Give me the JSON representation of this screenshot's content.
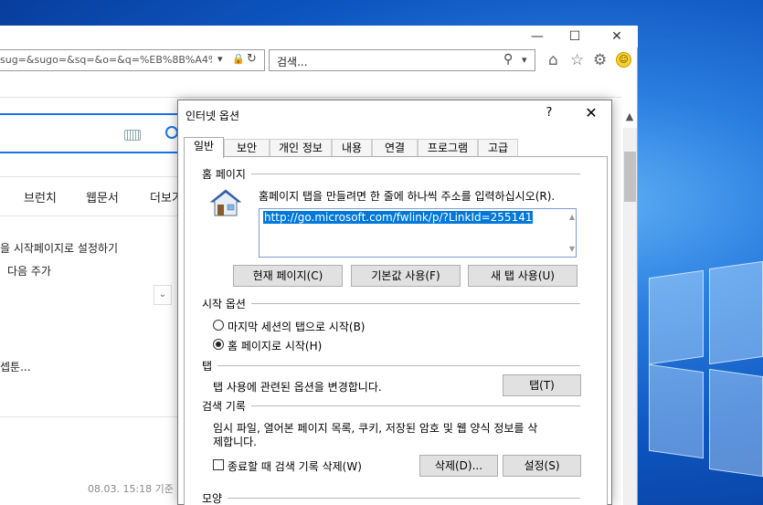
{
  "colors": {
    "accent": "#1a73e8",
    "selection": "#0078d7",
    "desktop": "#0d55c0"
  },
  "browser": {
    "window_controls": {
      "minimize": "—",
      "maximize": "☐",
      "close": "✕"
    },
    "address": {
      "value": "sug=&sugo=&sq=&o=&q=%EB%8B%A4%",
      "icons": [
        "dropdown-icon",
        "lock-icon",
        "refresh-icon"
      ]
    },
    "search": {
      "placeholder": "검색...",
      "icons": [
        "search-icon",
        "dropdown-icon"
      ]
    },
    "toolbar_icons": [
      "home-icon",
      "star-icon",
      "gear-icon",
      "smiley-icon"
    ],
    "page": {
      "nav": [
        "브런치",
        "웹문서",
        "더보기"
      ],
      "side": [
        "을 시작페이지로 설정하기",
        "다음 주가",
        "셉툰..."
      ],
      "timestamp": "08.03. 15:18 기준"
    }
  },
  "dialog": {
    "title": "인터넷 옵션",
    "help": "?",
    "close": "✕",
    "tabs": [
      "일반",
      "보안",
      "개인 정보",
      "내용",
      "연결",
      "프로그램",
      "고급"
    ],
    "active_tab": 0,
    "homepage": {
      "section": "홈 페이지",
      "instruction": "홈페이지 탭을 만들려면 한 줄에 하나씩 주소를 입력하십시오(R).",
      "url": "http://go.microsoft.com/fwlink/p/?LinkId=255141",
      "buttons": {
        "current": "현재 페이지(C)",
        "default": "기본값 사용(F)",
        "new_tab": "새 탭 사용(U)"
      }
    },
    "startup": {
      "section": "시작 옵션",
      "options": [
        "마지막 세션의 탭으로 시작(B)",
        "홈 페이지로 시작(H)"
      ],
      "selected": 1
    },
    "tabs_section": {
      "section": "탭",
      "text": "탭 사용에 관련된 옵션을 변경합니다.",
      "button": "탭(T)"
    },
    "history": {
      "section": "검색 기록",
      "text_line1": "임시 파일, 열어본 페이지 목록, 쿠키, 저장된 암호 및 웹 양식 정보를 삭",
      "text_line2": "제합니다.",
      "checkbox": "종료할 때 검색 기록 삭제(W)",
      "delete_button": "삭제(D)...",
      "settings_button": "설정(S)"
    },
    "appearance": {
      "section": "모양"
    }
  }
}
